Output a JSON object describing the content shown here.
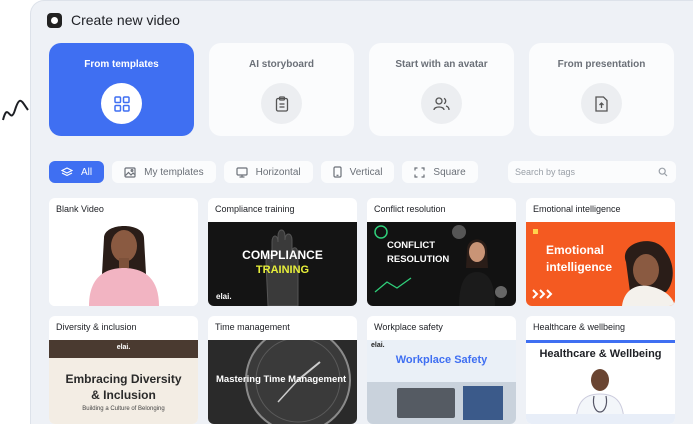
{
  "header": {
    "title": "Create new video",
    "icon": "video-camera-icon"
  },
  "source_cards": [
    {
      "label": "From templates",
      "icon": "grid-icon",
      "active": true
    },
    {
      "label": "AI storyboard",
      "icon": "clipboard-icon",
      "active": false
    },
    {
      "label": "Start with an avatar",
      "icon": "users-icon",
      "active": false
    },
    {
      "label": "From presentation",
      "icon": "file-upload-icon",
      "active": false
    }
  ],
  "filters": [
    {
      "label": "All",
      "icon": "layers-icon",
      "active": true
    },
    {
      "label": "My templates",
      "icon": "image-icon",
      "active": false
    },
    {
      "label": "Horizontal",
      "icon": "monitor-icon",
      "active": false
    },
    {
      "label": "Vertical",
      "icon": "phone-icon",
      "active": false
    },
    {
      "label": "Square",
      "icon": "square-crop-icon",
      "active": false
    }
  ],
  "search": {
    "placeholder": "Search by tags"
  },
  "templates": [
    {
      "name": "Blank Video"
    },
    {
      "name": "Compliance training",
      "line1": "COMPLIANCE",
      "line2": "TRAINING",
      "brand": "elai."
    },
    {
      "name": "Conflict resolution",
      "line1": "CONFLICT",
      "line2": "RESOLUTION"
    },
    {
      "name": "Emotional intelligence",
      "line1": "Emotional",
      "line2": "intelligence"
    },
    {
      "name": "Diversity & inclusion",
      "line1": "Embracing Diversity",
      "line2": "& Inclusion",
      "line3": "Building a Culture of Belonging",
      "brand": "elai."
    },
    {
      "name": "Time management",
      "line1": "Mastering Time Management"
    },
    {
      "name": "Workplace safety",
      "line1": "Workplace Safety",
      "brand": "elai."
    },
    {
      "name": "Healthcare & wellbeing",
      "line1": "Healthcare & Wellbeing"
    }
  ],
  "colors": {
    "accent": "#3f6ff2",
    "panel": "#eef1f6",
    "emotional_bg": "#f45a21",
    "compliance_yellow": "#e8f03a"
  }
}
